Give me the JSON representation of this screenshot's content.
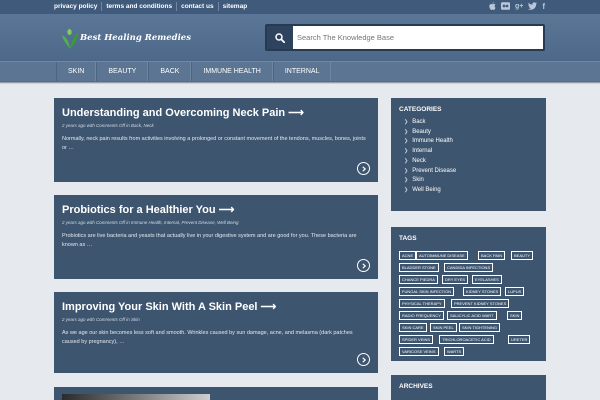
{
  "top_links": [
    "privacy policy",
    "terms and conditions",
    "contact us",
    "sitemap"
  ],
  "social_icons": [
    "apple-icon",
    "flickr-icon",
    "google-plus-icon",
    "twitter-icon",
    "facebook-icon"
  ],
  "site": {
    "name": "Best Healing Remedies",
    "logo_color": "#4fb34a"
  },
  "search": {
    "placeholder": "Search The Knowledge Base"
  },
  "nav": [
    "SKIN",
    "BEAUTY",
    "BACK",
    "IMMUNE HEALTH",
    "INTERNAL"
  ],
  "posts": [
    {
      "title": "Understanding and Overcoming Neck Pain ⟶",
      "meta": "2 years ago with Comments Off in Back, Neck",
      "excerpt": "Normally, neck pain results from activities involving a prolonged or constant movement of the tendons, muscles, bones, joints or …"
    },
    {
      "title": "Probiotics for a Healthier You ⟶",
      "meta": "2 years ago with Comments Off in Immune Health, Internal, Prevent Disease, Well Being",
      "excerpt": "Probiotics are live bacteria and yeasts that actually live in your digestive system and are good for you.  These bacteria are known as …"
    },
    {
      "title": "Improving Your Skin With A Skin Peel ⟶",
      "meta": "2 years ago with Comments Off in Skin",
      "excerpt": "As we age our skin becomes less soft and smooth. Wrinkles caused by sun damage, acne, and melasma (dark patches caused by pregnancy), …"
    }
  ],
  "categories": {
    "title": "CATEGORIES",
    "items": [
      "Back",
      "Beauty",
      "Immune Health",
      "Internal",
      "Neck",
      "Prevent Disease",
      "Skin",
      "Well Being"
    ]
  },
  "tags": {
    "title": "TAGS",
    "items": [
      "ACNE",
      "AUTOIMMUNE DISEASE",
      "BACK PAIN",
      "BEAUTY",
      "BLADDER STONE",
      "CANDIDA INFECTIONS",
      "CHANCE PIEDRA",
      "DRY EYES",
      "EYELASHES",
      "FUNGAL SKIN INFECTION",
      "KIDNEY STONES",
      "LUPUS",
      "PHYSICAL THERAPY",
      "PREVENT KIDNEY STONES",
      "RADIO FREQUENCY",
      "SALICYLIC ACID WART",
      "SKIN",
      "SKIN CARE",
      "SKIN PEEL",
      "SKIN TIGHTENING",
      "SPIDER VEINS",
      "TRICHLOROACETIC ACID",
      "URETER",
      "VARICOSE VEINS",
      "WARTS"
    ]
  },
  "archives": {
    "title": "ARCHIVES"
  }
}
